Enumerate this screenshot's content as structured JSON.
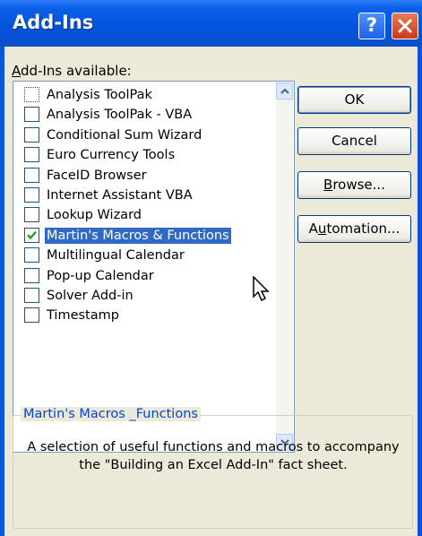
{
  "window": {
    "title": "Add-Ins",
    "help_glyph": "?",
    "close_icon": "close-x-icon"
  },
  "list": {
    "label_prefix": "A",
    "label_rest": "dd-Ins available:",
    "items": [
      {
        "label": "Analysis ToolPak",
        "checked": false
      },
      {
        "label": "Analysis ToolPak - VBA",
        "checked": false
      },
      {
        "label": "Conditional Sum Wizard",
        "checked": false
      },
      {
        "label": "Euro Currency Tools",
        "checked": false
      },
      {
        "label": "FaceID Browser",
        "checked": false
      },
      {
        "label": "Internet Assistant VBA",
        "checked": false
      },
      {
        "label": "Lookup Wizard",
        "checked": false
      },
      {
        "label": "Martin's Macros & Functions",
        "checked": true,
        "selected": true
      },
      {
        "label": "Multilingual Calendar",
        "checked": false
      },
      {
        "label": "Pop-up Calendar",
        "checked": false
      },
      {
        "label": "Solver Add-in",
        "checked": false
      },
      {
        "label": "Timestamp",
        "checked": false
      }
    ]
  },
  "buttons": {
    "ok": "OK",
    "cancel": "Cancel",
    "browse_accel": "B",
    "browse_rest": "rowse...",
    "automation_pre": "A",
    "automation_accel": "u",
    "automation_rest": "tomation..."
  },
  "details": {
    "title": "Martin's Macros _Functions",
    "description": "A selection of useful functions and macros to accompany the \"Building an Excel Add-In\" fact sheet."
  },
  "colors": {
    "title_bar": "#0454de",
    "selection": "#316ac5",
    "dialog_bg": "#ece9d8",
    "group_title": "#0046d5",
    "checkmark": "#21a121"
  }
}
